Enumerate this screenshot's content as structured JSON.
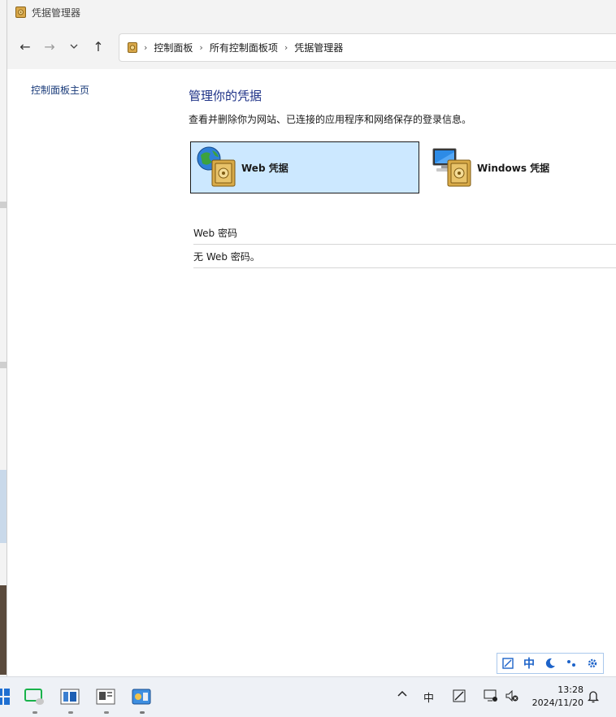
{
  "window": {
    "title": "凭据管理器"
  },
  "nav": {
    "back_icon": "arrow-left-icon",
    "forward_icon": "arrow-right-icon",
    "recent_icon": "chevron-down-icon",
    "up_icon": "arrow-up-icon"
  },
  "breadcrumb": [
    "控制面板",
    "所有控制面板项",
    "凭据管理器"
  ],
  "sidebar": {
    "home_link": "控制面板主页"
  },
  "main": {
    "heading": "管理你的凭据",
    "description": "查看并删除你为网站、已连接的应用程序和网络保存的登录信息。",
    "tiles": [
      {
        "label": "Web 凭据",
        "selected": true,
        "icon": "globe-vault-icon"
      },
      {
        "label": "Windows 凭据",
        "selected": false,
        "icon": "computer-vault-icon"
      }
    ],
    "section": {
      "title": "Web 密码",
      "empty_text": "无 Web 密码。"
    }
  },
  "ime": {
    "mode": "中"
  },
  "taskbar": {
    "clock_time": "13:28",
    "clock_date": "2024/11/20",
    "ime_indicator": "中"
  },
  "colors": {
    "accent": "#1e3287",
    "selected_tile": "#cce8ff",
    "link": "#1a3b7a"
  }
}
